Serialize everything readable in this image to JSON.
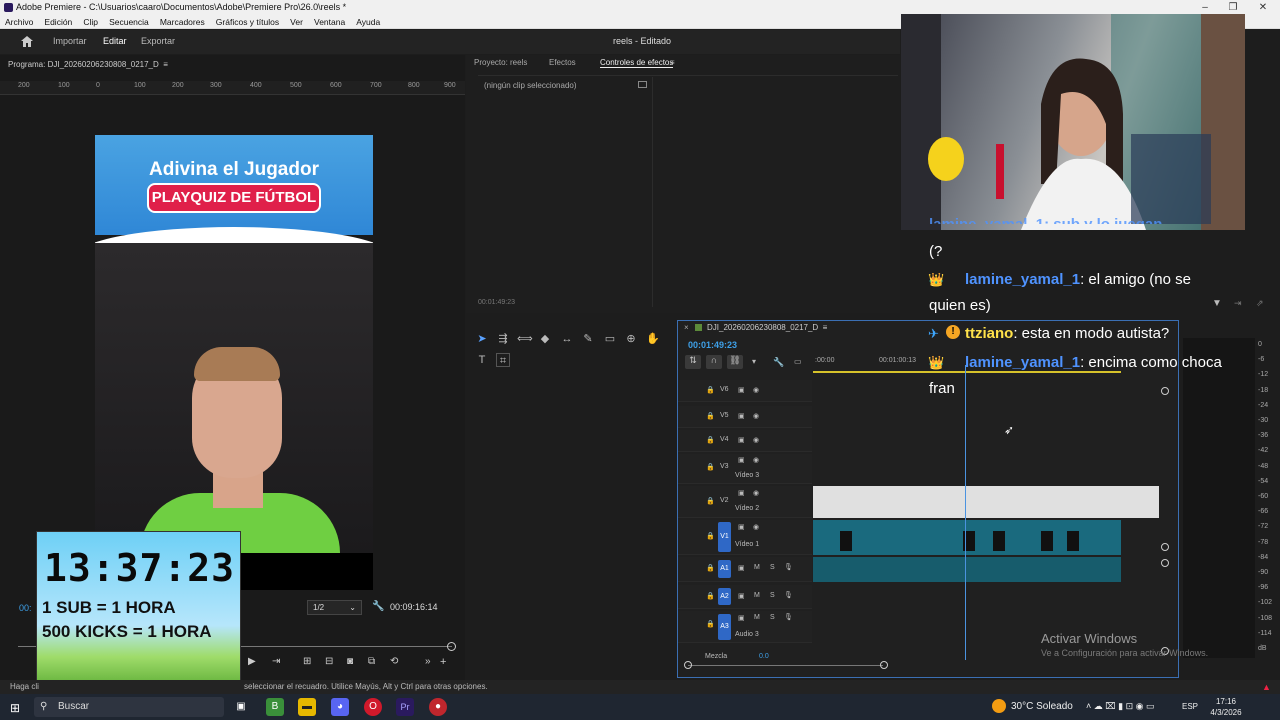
{
  "titlebar": {
    "title": "Adobe Premiere - C:\\Usuarios\\caaro\\Documentos\\Adobe\\Premiere Pro\\26.0\\reels *"
  },
  "menu": [
    "Archivo",
    "Edición",
    "Clip",
    "Secuencia",
    "Marcadores",
    "Gráficos y títulos",
    "Ver",
    "Ventana",
    "Ayuda"
  ],
  "header": {
    "import": "Importar",
    "edit": "Editar",
    "export": "Exportar",
    "project_title": "reels - Editado"
  },
  "program": {
    "title": "Programa: DJI_20260206230808_0217_D",
    "timecode_left": "00:",
    "timecode_right": "00:09:16:14",
    "fit": "1/2",
    "ruler": [
      "200",
      "100",
      "0",
      "100",
      "200",
      "300",
      "400",
      "500",
      "600",
      "700",
      "800",
      "900"
    ]
  },
  "video": {
    "title": "Adivina el Jugador",
    "pill": "PLAYQUIZ DE FÚTBOL"
  },
  "overlay": {
    "time": "13:37:23",
    "line1": "1 SUB = 1 HORA",
    "line2": "500 KICKS = 1 HORA"
  },
  "effects": {
    "tab_project": "Proyecto: reels",
    "tab_effects": "Efectos",
    "tab_controls": "Controles de efectos",
    "no_clip": "(ningún clip seleccionado)",
    "timecode": "00:01:49:23"
  },
  "timeline": {
    "name": "DJI_20260206230808_0217_D",
    "timecode": "00:01:49:23",
    "ruler_start": ":00:00",
    "ruler_mid": "00:01:00:13",
    "tracks": [
      {
        "id": "V6",
        "label": ""
      },
      {
        "id": "V5",
        "label": ""
      },
      {
        "id": "V4",
        "label": ""
      },
      {
        "id": "V3",
        "label": "Vídeo 3"
      },
      {
        "id": "V2",
        "label": "Vídeo 2"
      },
      {
        "id": "V1",
        "label": "Vídeo 1"
      },
      {
        "id": "A1",
        "label": ""
      },
      {
        "id": "A2",
        "label": ""
      },
      {
        "id": "A3",
        "label": "Audio 3"
      }
    ],
    "mix_label": "Mezcla",
    "mix_value": "0.0"
  },
  "meter_scale": [
    "0",
    "-6",
    "-12",
    "-18",
    "-24",
    "-30",
    "-36",
    "-42",
    "-48",
    "-54",
    "-60",
    "-66",
    "-72",
    "-78",
    "-84",
    "-90",
    "-96",
    "-102",
    "-108",
    "-114",
    "dB"
  ],
  "chat": [
    {
      "user": "",
      "text": "(?"
    },
    {
      "user": "lamine_yamal_1",
      "text": ": el amigo (no se quien es)"
    },
    {
      "user": "ttziano",
      "text": ": esta en modo autista?"
    },
    {
      "user": "lamine_yamal_1",
      "text": ": encima como choca fran"
    }
  ],
  "chat_top_partial": "lamine_yamal_1: sub y lo juegan",
  "watermark": {
    "line1": "Activar Windows",
    "line2": "Ve a Configuración para activar Windows."
  },
  "status": {
    "text": "Haga cli",
    "text2": "seleccionar el recuadro. Utilice Mayús, Alt y Ctrl para otras opciones."
  },
  "taskbar": {
    "search": "Buscar",
    "weather": "30°C  Soleado",
    "lang": "ESP",
    "time": "17:16",
    "date": "4/3/2026"
  }
}
